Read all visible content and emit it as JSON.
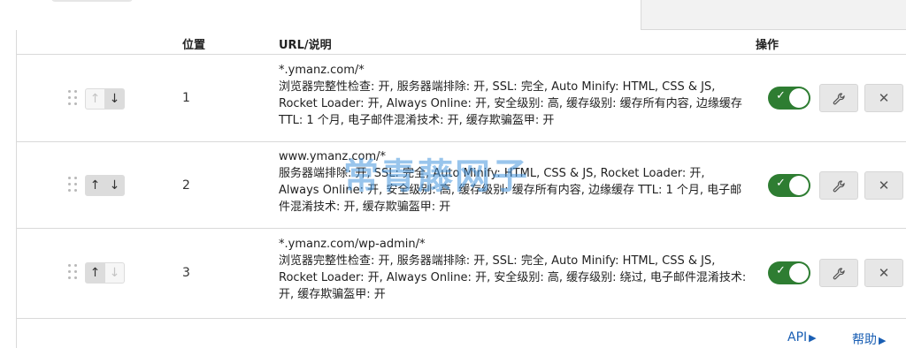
{
  "header": {
    "position": "位置",
    "url_desc": "URL/说明",
    "operations": "操作"
  },
  "rows": [
    {
      "position": "1",
      "pattern": "*.ymanz.com/*",
      "description": "浏览器完整性检查: 开, 服务器端排除: 开, SSL: 完全, Auto Minify: HTML, CSS & JS, Rocket Loader: 开, Always Online: 开, 安全级别: 高, 缓存级别: 缓存所有内容, 边缘缓存 TTL: 1 个月, 电子邮件混淆技术: 开, 缓存欺骗盔甲: 开",
      "enabled": true,
      "up_enabled": false,
      "down_enabled": true
    },
    {
      "position": "2",
      "pattern": "www.ymanz.com/*",
      "description": "服务器端排除: 开, SSL: 完全, Auto Minify: HTML, CSS & JS, Rocket Loader: 开, Always Online: 开, 安全级别: 高, 缓存级别: 缓存所有内容, 边缘缓存 TTL: 1 个月, 电子邮件混淆技术: 开, 缓存欺骗盔甲: 开",
      "enabled": true,
      "up_enabled": true,
      "down_enabled": true
    },
    {
      "position": "3",
      "pattern": "*.ymanz.com/wp-admin/*",
      "description": "浏览器完整性检查: 开, 服务器端排除: 开, SSL: 完全, Auto Minify: HTML, CSS & JS, Rocket Loader: 开, Always Online: 开, 安全级别: 高, 缓存级别: 绕过, 电子邮件混淆技术: 开, 缓存欺骗盔甲: 开",
      "enabled": true,
      "up_enabled": true,
      "down_enabled": false
    }
  ],
  "icons": {
    "drag": "drag-handle-icon",
    "up": "↑",
    "down": "↓",
    "check": "✓",
    "edit": "wrench-icon",
    "delete": "✕",
    "triangle": "▶"
  },
  "footer": {
    "api_label": "API",
    "help_label": "帮助"
  },
  "watermark": "常青藤网子",
  "colors": {
    "toggle_on": "#2e7d32",
    "link": "#1a5fb4"
  }
}
